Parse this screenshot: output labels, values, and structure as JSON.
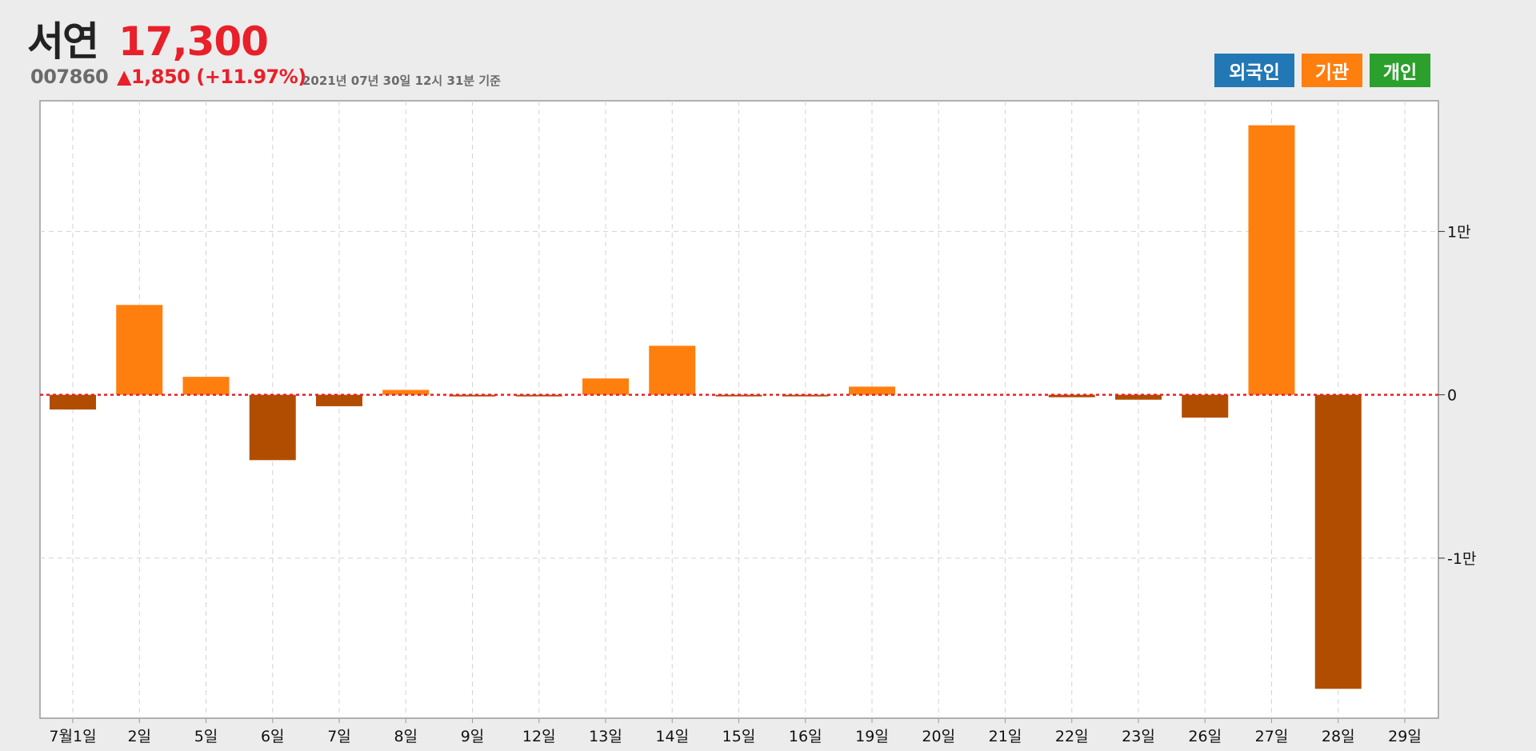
{
  "header": {
    "name": "서연",
    "price": "17,300",
    "code": "007860",
    "change": "▲1,850 (+11.97%)",
    "timestamp": "2021년 07년 30일 12시 31분 기준"
  },
  "legend": [
    {
      "label": "외국인",
      "color": "#2278b5"
    },
    {
      "label": "기관",
      "color": "#ff7f0e"
    },
    {
      "label": "개인",
      "color": "#2ca02c"
    }
  ],
  "colors": {
    "positive": "#ff7f0e",
    "negative": "#b14d00",
    "zero_line": "#e8202a",
    "grid": "#d3d3d3",
    "plot_bg": "#ffffff",
    "frame": "#999999"
  },
  "chart_data": {
    "type": "bar",
    "series_name": "기관",
    "categories": [
      "7월1일",
      "2일",
      "5일",
      "6일",
      "7일",
      "8일",
      "9일",
      "12일",
      "13일",
      "14일",
      "15일",
      "16일",
      "19일",
      "20일",
      "21일",
      "22일",
      "23일",
      "26일",
      "27일",
      "28일",
      "29일"
    ],
    "values": [
      -900,
      5500,
      1100,
      -4000,
      -700,
      300,
      -100,
      -50,
      1000,
      3000,
      -50,
      -50,
      500,
      0,
      0,
      -150,
      -300,
      -1400,
      16500,
      -18000,
      0
    ],
    "ylim": [
      -19800,
      18000
    ],
    "yticks": [
      {
        "value": 10000,
        "label": "1만"
      },
      {
        "value": 0,
        "label": "0"
      },
      {
        "value": -10000,
        "label": "-1만"
      }
    ],
    "grid": true,
    "zero_line": "dotted"
  }
}
